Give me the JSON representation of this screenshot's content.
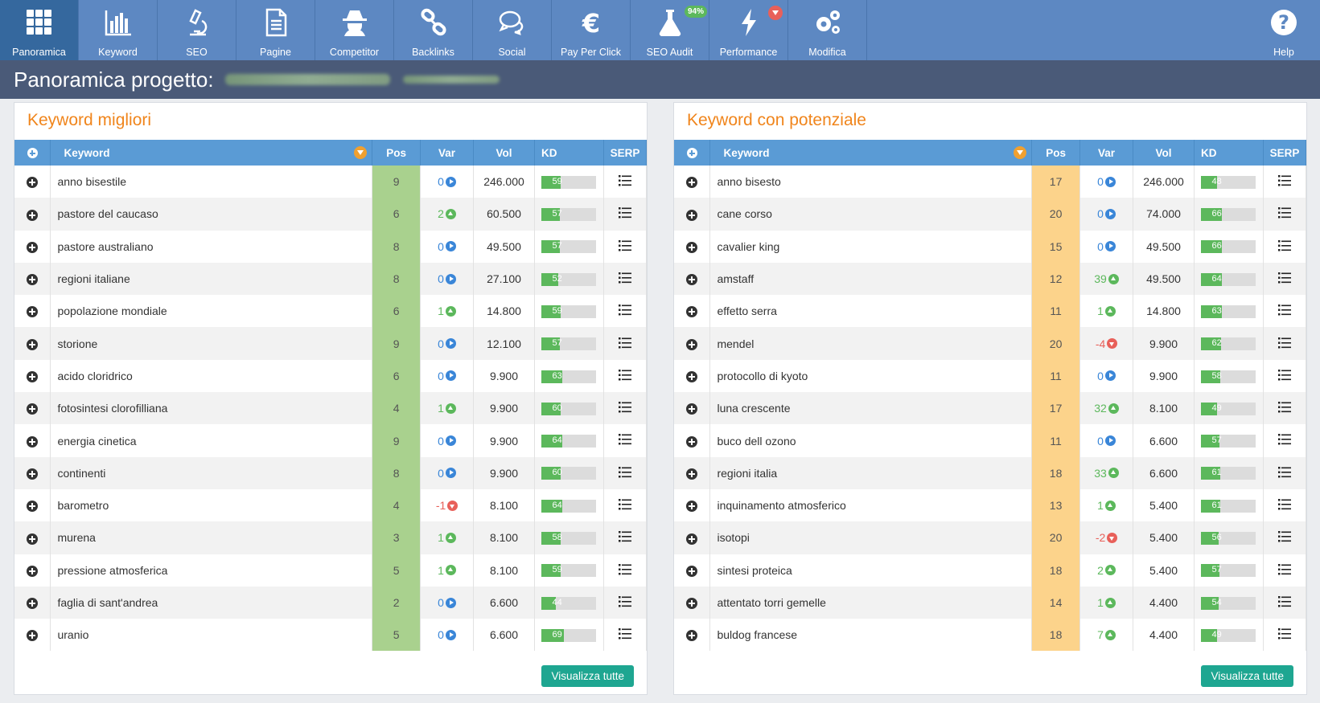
{
  "nav": {
    "items": [
      {
        "label": "Panoramica",
        "icon": "grid-icon",
        "active": true
      },
      {
        "label": "Keyword",
        "icon": "bar-chart-icon"
      },
      {
        "label": "SEO",
        "icon": "microscope-icon"
      },
      {
        "label": "Pagine",
        "icon": "document-icon"
      },
      {
        "label": "Competitor",
        "icon": "spy-icon"
      },
      {
        "label": "Backlinks",
        "icon": "link-icon"
      },
      {
        "label": "Social",
        "icon": "chat-bubbles-icon"
      },
      {
        "label": "Pay Per Click",
        "icon": "euro-icon"
      },
      {
        "label": "SEO Audit",
        "icon": "flask-icon",
        "badge": "94%"
      },
      {
        "label": "Performance",
        "icon": "lightning-icon",
        "badge_down": true
      },
      {
        "label": "Modifica",
        "icon": "gears-icon"
      }
    ],
    "help": {
      "label": "Help",
      "icon": "question-circle-icon"
    }
  },
  "page": {
    "title": "Panoramica progetto:"
  },
  "colors": {
    "nav": "#5d88c2",
    "accent": "#f0851c",
    "header": "#5a9bd5",
    "good": "#5cb85c",
    "bad": "#e8605a",
    "neutral": "#3a86d8",
    "button": "#1ea691"
  },
  "columns": {
    "keyword": "Keyword",
    "pos": "Pos",
    "var": "Var",
    "vol": "Vol",
    "kd": "KD",
    "serp": "SERP"
  },
  "left": {
    "title": "Keyword migliori",
    "button": "Visualizza tutte",
    "rows": [
      {
        "keyword": "anno bisestile",
        "pos": "9",
        "var": "0",
        "dir": "z",
        "vol": "246.000",
        "kd": 59
      },
      {
        "keyword": "pastore del caucaso",
        "pos": "6",
        "var": "2",
        "dir": "u",
        "vol": "60.500",
        "kd": 57
      },
      {
        "keyword": "pastore australiano",
        "pos": "8",
        "var": "0",
        "dir": "z",
        "vol": "49.500",
        "kd": 57
      },
      {
        "keyword": "regioni italiane",
        "pos": "8",
        "var": "0",
        "dir": "z",
        "vol": "27.100",
        "kd": 52
      },
      {
        "keyword": "popolazione mondiale",
        "pos": "6",
        "var": "1",
        "dir": "u",
        "vol": "14.800",
        "kd": 59
      },
      {
        "keyword": "storione",
        "pos": "9",
        "var": "0",
        "dir": "z",
        "vol": "12.100",
        "kd": 57
      },
      {
        "keyword": "acido cloridrico",
        "pos": "6",
        "var": "0",
        "dir": "z",
        "vol": "9.900",
        "kd": 63
      },
      {
        "keyword": "fotosintesi clorofilliana",
        "pos": "4",
        "var": "1",
        "dir": "u",
        "vol": "9.900",
        "kd": 60
      },
      {
        "keyword": "energia cinetica",
        "pos": "9",
        "var": "0",
        "dir": "z",
        "vol": "9.900",
        "kd": 64
      },
      {
        "keyword": "continenti",
        "pos": "8",
        "var": "0",
        "dir": "z",
        "vol": "9.900",
        "kd": 60
      },
      {
        "keyword": "barometro",
        "pos": "4",
        "var": "-1",
        "dir": "d",
        "vol": "8.100",
        "kd": 64
      },
      {
        "keyword": "murena",
        "pos": "3",
        "var": "1",
        "dir": "u",
        "vol": "8.100",
        "kd": 58
      },
      {
        "keyword": "pressione atmosferica",
        "pos": "5",
        "var": "1",
        "dir": "u",
        "vol": "8.100",
        "kd": 59
      },
      {
        "keyword": "faglia di sant'andrea",
        "pos": "2",
        "var": "0",
        "dir": "z",
        "vol": "6.600",
        "kd": 44
      },
      {
        "keyword": "uranio",
        "pos": "5",
        "var": "0",
        "dir": "z",
        "vol": "6.600",
        "kd": 69
      }
    ]
  },
  "right": {
    "title": "Keyword con potenziale",
    "button": "Visualizza tutte",
    "rows": [
      {
        "keyword": "anno bisesto",
        "pos": "17",
        "var": "0",
        "dir": "z",
        "vol": "246.000",
        "kd": 48
      },
      {
        "keyword": "cane corso",
        "pos": "20",
        "var": "0",
        "dir": "z",
        "vol": "74.000",
        "kd": 66
      },
      {
        "keyword": "cavalier king",
        "pos": "15",
        "var": "0",
        "dir": "z",
        "vol": "49.500",
        "kd": 66
      },
      {
        "keyword": "amstaff",
        "pos": "12",
        "var": "39",
        "dir": "u",
        "vol": "49.500",
        "kd": 64
      },
      {
        "keyword": "effetto serra",
        "pos": "11",
        "var": "1",
        "dir": "u",
        "vol": "14.800",
        "kd": 63
      },
      {
        "keyword": "mendel",
        "pos": "20",
        "var": "-4",
        "dir": "d",
        "vol": "9.900",
        "kd": 62
      },
      {
        "keyword": "protocollo di kyoto",
        "pos": "11",
        "var": "0",
        "dir": "z",
        "vol": "9.900",
        "kd": 58
      },
      {
        "keyword": "luna crescente",
        "pos": "17",
        "var": "32",
        "dir": "u",
        "vol": "8.100",
        "kd": 49
      },
      {
        "keyword": "buco dell ozono",
        "pos": "11",
        "var": "0",
        "dir": "z",
        "vol": "6.600",
        "kd": 57
      },
      {
        "keyword": "regioni italia",
        "pos": "18",
        "var": "33",
        "dir": "u",
        "vol": "6.600",
        "kd": 61
      },
      {
        "keyword": "inquinamento atmosferico",
        "pos": "13",
        "var": "1",
        "dir": "u",
        "vol": "5.400",
        "kd": 61
      },
      {
        "keyword": "isotopi",
        "pos": "20",
        "var": "-2",
        "dir": "d",
        "vol": "5.400",
        "kd": 56
      },
      {
        "keyword": "sintesi proteica",
        "pos": "18",
        "var": "2",
        "dir": "u",
        "vol": "5.400",
        "kd": 57
      },
      {
        "keyword": "attentato torri gemelle",
        "pos": "14",
        "var": "1",
        "dir": "u",
        "vol": "4.400",
        "kd": 54
      },
      {
        "keyword": "buldog francese",
        "pos": "18",
        "var": "7",
        "dir": "u",
        "vol": "4.400",
        "kd": 49
      }
    ]
  }
}
